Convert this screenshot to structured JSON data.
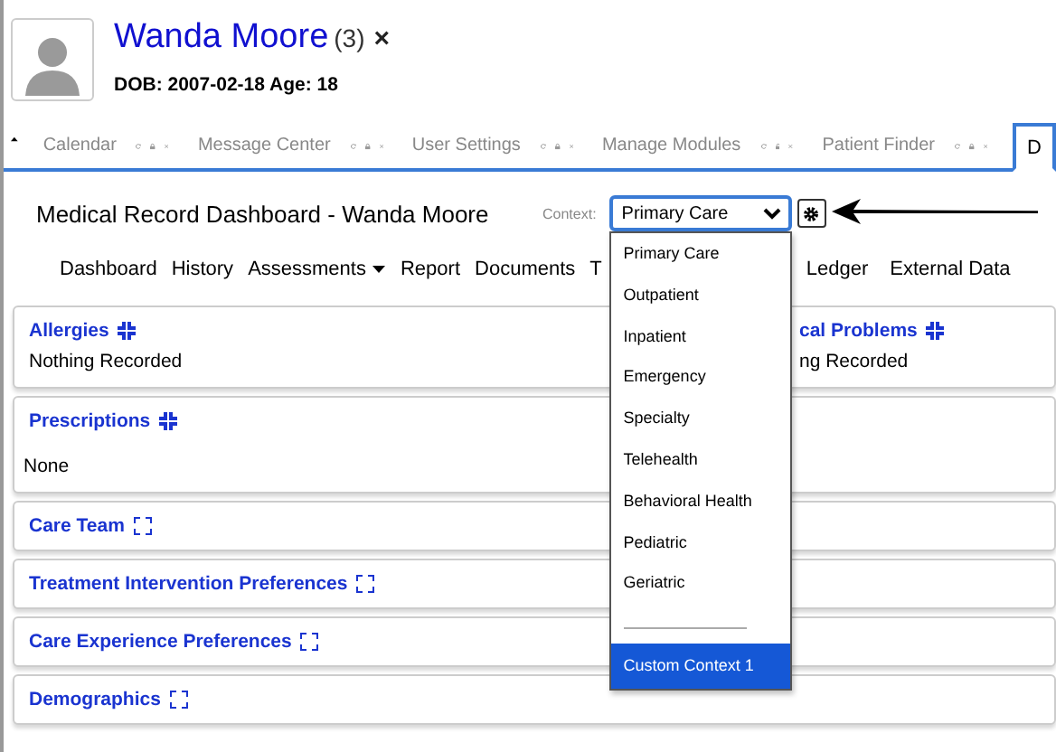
{
  "patient": {
    "name": "Wanda Moore",
    "count": "(3)",
    "close": "×",
    "dob": "DOB: 2007-02-18 Age: 18"
  },
  "tabs": [
    {
      "label": "Calendar",
      "selected": false
    },
    {
      "label": "Message Center",
      "selected": false
    },
    {
      "label": "User Settings",
      "selected": false
    },
    {
      "label": "Manage Modules",
      "selected": false
    },
    {
      "label": "Patient Finder",
      "selected": false
    },
    {
      "label": "D",
      "selected": true
    }
  ],
  "dashboard": {
    "title": "Medical Record Dashboard - Wanda Moore",
    "context_label": "Context:",
    "context_value": "Primary Care"
  },
  "nav": [
    {
      "label": "Dashboard",
      "kind": "link"
    },
    {
      "label": "History",
      "kind": "link"
    },
    {
      "label": "Assessments",
      "kind": "menu"
    },
    {
      "label": "Report",
      "kind": "link"
    },
    {
      "label": "Documents",
      "kind": "link"
    },
    {
      "label": "T",
      "kind": "link"
    },
    {
      "label": "Ledger",
      "kind": "link"
    },
    {
      "label": "External Data",
      "kind": "link"
    }
  ],
  "context_menu": [
    {
      "kind": "option",
      "label": "Primary Care",
      "selected": false
    },
    {
      "kind": "option",
      "label": "Outpatient",
      "selected": false
    },
    {
      "kind": "option",
      "label": "Inpatient",
      "selected": false
    },
    {
      "kind": "option",
      "label": "Emergency",
      "selected": false
    },
    {
      "kind": "option",
      "label": "Specialty",
      "selected": false
    },
    {
      "kind": "option",
      "label": "Telehealth",
      "selected": false
    },
    {
      "kind": "option",
      "label": "Behavioral Health",
      "selected": false
    },
    {
      "kind": "option",
      "label": "Pediatric",
      "selected": false
    },
    {
      "kind": "option",
      "label": "Geriatric",
      "selected": false
    },
    {
      "kind": "separator"
    },
    {
      "kind": "option",
      "label": "Custom Context 1",
      "selected": true
    }
  ],
  "panels": [
    {
      "title": "Allergies",
      "expanded": true,
      "content": "Nothing Recorded"
    },
    {
      "title": "cal Problems",
      "expanded": true,
      "content": "ng Recorded"
    },
    {
      "title": "Prescriptions",
      "expanded": true,
      "content": "None"
    },
    {
      "title": "Care Team",
      "expanded": false
    },
    {
      "title": "Treatment Intervention Preferences",
      "expanded": false
    },
    {
      "title": "Care Experience Preferences",
      "expanded": false
    },
    {
      "title": "Demographics",
      "expanded": false
    }
  ]
}
